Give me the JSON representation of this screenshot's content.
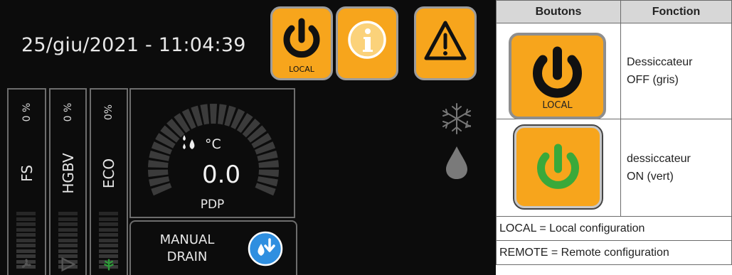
{
  "panel": {
    "datetime": "25/giu/2021 - 11:04:39",
    "buttons": [
      {
        "name": "power-local-button",
        "icon": "power-icon",
        "label": "LOCAL"
      },
      {
        "name": "info-button",
        "icon": "info-icon",
        "label": ""
      },
      {
        "name": "warning-button",
        "icon": "warning-icon",
        "label": ""
      }
    ],
    "bars": [
      {
        "name": "FS",
        "percent": "0 %",
        "icon": "fan-icon"
      },
      {
        "name": "HGBV",
        "percent": "0 %",
        "icon": "play-icon"
      },
      {
        "name": "ECO",
        "percent": "0%",
        "icon": "leaf-icon"
      }
    ],
    "gauge": {
      "unit": "°C",
      "value": "0.0",
      "label": "PDP",
      "icon": "droplets-icon"
    },
    "drain": {
      "line1": "MANUAL",
      "line2": "DRAIN",
      "icon": "drain-drop-icon"
    },
    "status_icons": [
      "snowflake-icon",
      "water-drop-icon"
    ],
    "colors": {
      "accent": "#f7a51c",
      "background": "#0c0c0c",
      "on_green": "#3aa93a",
      "drain_blue": "#2f8fe0"
    }
  },
  "table": {
    "headers": [
      "Boutons",
      "Fonction"
    ],
    "rows": [
      {
        "button_label": "LOCAL",
        "function_line1": "Dessiccateur",
        "function_line2": "OFF (gris)"
      },
      {
        "button_label": "",
        "function_line1": "dessiccateur",
        "function_line2": "ON (vert)"
      }
    ],
    "footnotes": [
      "LOCAL = Local configuration",
      "REMOTE = Remote configuration"
    ]
  }
}
